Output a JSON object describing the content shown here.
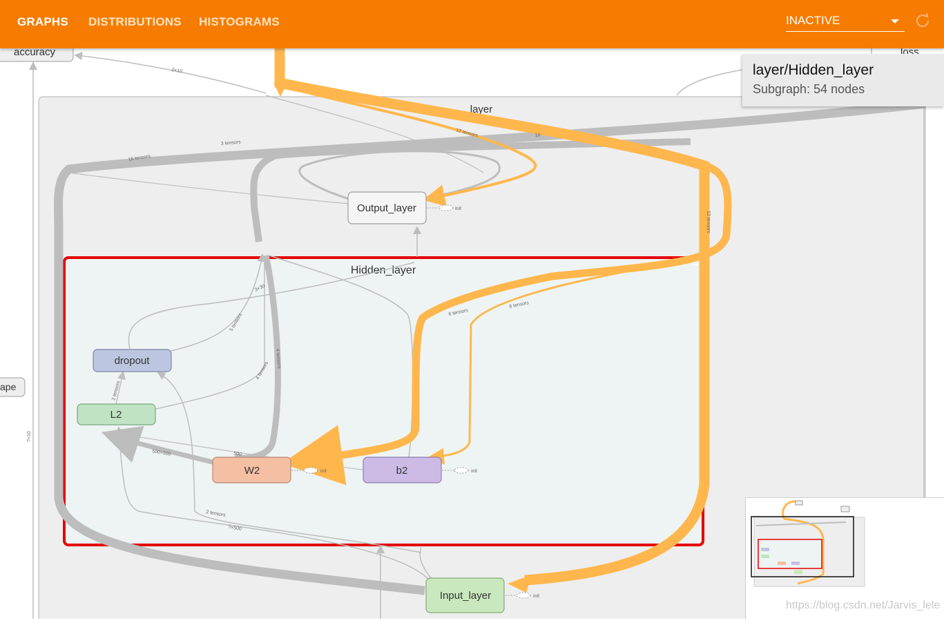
{
  "nav": {
    "tabs": [
      {
        "label": "GRAPHS",
        "active": true
      },
      {
        "label": "DISTRIBUTIONS",
        "active": false
      },
      {
        "label": "HISTOGRAMS",
        "active": false
      }
    ],
    "run_selector": {
      "value": "INACTIVE"
    },
    "reload_icon": "refresh-icon"
  },
  "info_card": {
    "title": "layer/Hidden_layer",
    "subtitle": "Subgraph: 54 nodes"
  },
  "graph": {
    "outer_group_label": "layer",
    "selected_group_label": "Hidden_layer",
    "nodes": {
      "accuracy": "accuracy",
      "loss": "loss",
      "shape": "ape",
      "output_layer": "Output_layer",
      "dropout": "dropout",
      "l2": "L2",
      "w2": "W2",
      "b2": "b2",
      "input_layer": "Input_layer",
      "init": "init"
    },
    "edge_labels": {
      "e_16_tensors": "16 tensors",
      "e_3_tensors": "3 tensors",
      "e_12_tensors_a": "12 tensors",
      "e_12_tensors_b": "12 tensors",
      "e_6_tensors_a": "6 tensors",
      "e_6_tensors_b": "6 tensors",
      "e_4_tensors_a": "4 tensors",
      "e_4_tensors_b": "4 tensors",
      "e_5_tensors": "5 tensors",
      "e_2_tensors_a": "2 tensors",
      "e_2_tensors_b": "2 tensors",
      "e_16_b": "16",
      "e_2x10": "2×10",
      "e_500x500": "500×500",
      "e_500": "500",
      "e_500_b": "?×500",
      "e_7x10": "?×10",
      "e_3x30": "3×30"
    },
    "colors": {
      "header": "#f57c00",
      "orange_edge": "#ffb74d",
      "gray_edge": "#bdbdbd",
      "selection": "#e50000",
      "variable_node": "#f4bfa3",
      "bias_node": "#cdbbe6",
      "dropout_node": "#bcc6e0",
      "l2_node": "#bfe3c3",
      "input_node": "#c9e8bd"
    }
  },
  "watermark": "https://blog.csdn.net/Jarvis_lele"
}
